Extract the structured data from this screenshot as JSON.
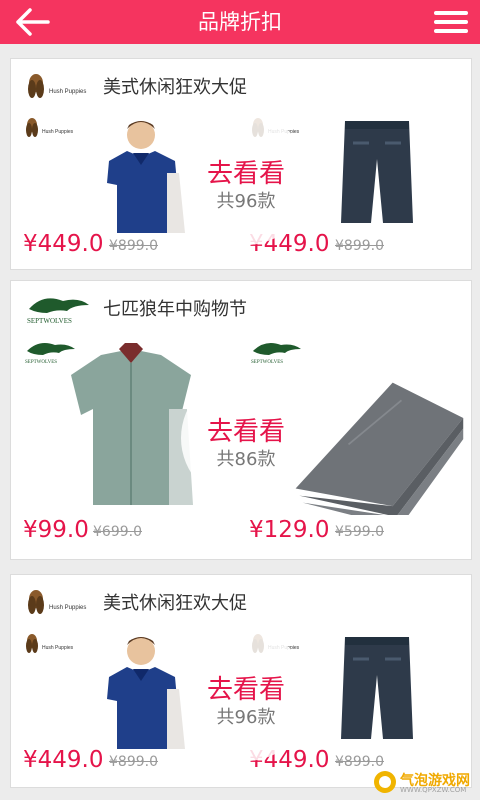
{
  "header": {
    "title": "品牌折扣",
    "back_icon": "back-arrow-icon",
    "menu_icon": "menu-icon",
    "bg": "#f5345f"
  },
  "cards": [
    {
      "brand": "美式休闲狂欢大促",
      "logo_text": "Hush Puppies",
      "left": {
        "price": "¥449.0",
        "old_price": "¥899.0",
        "product": "polo-shirt"
      },
      "right": {
        "price": "¥449.0",
        "old_price": "¥899.0",
        "product": "denim-shorts"
      },
      "cta": "去看看",
      "count": "共96款"
    },
    {
      "brand": "七匹狼年中购物节",
      "logo_text": "SEPTWOLVES",
      "left": {
        "price": "¥99.0",
        "old_price": "¥699.0",
        "product": "shirt"
      },
      "right": {
        "price": "¥129.0",
        "old_price": "¥599.0",
        "product": "trousers"
      },
      "cta": "去看看",
      "count": "共86款"
    },
    {
      "brand": "美式休闲狂欢大促",
      "logo_text": "Hush Puppies",
      "left": {
        "price": "¥449.0",
        "old_price": "¥899.0",
        "product": "polo-shirt"
      },
      "right": {
        "price": "¥449.0",
        "old_price": "¥899.0",
        "product": "denim-shorts"
      },
      "cta": "去看看",
      "count": "共96款"
    }
  ],
  "watermark": {
    "text": "气泡游戏网",
    "sub": "WWW.QPXZW.COM"
  },
  "colors": {
    "price": "#e5144a",
    "old_price": "#9a9a9a",
    "accent": "#f5345f"
  }
}
